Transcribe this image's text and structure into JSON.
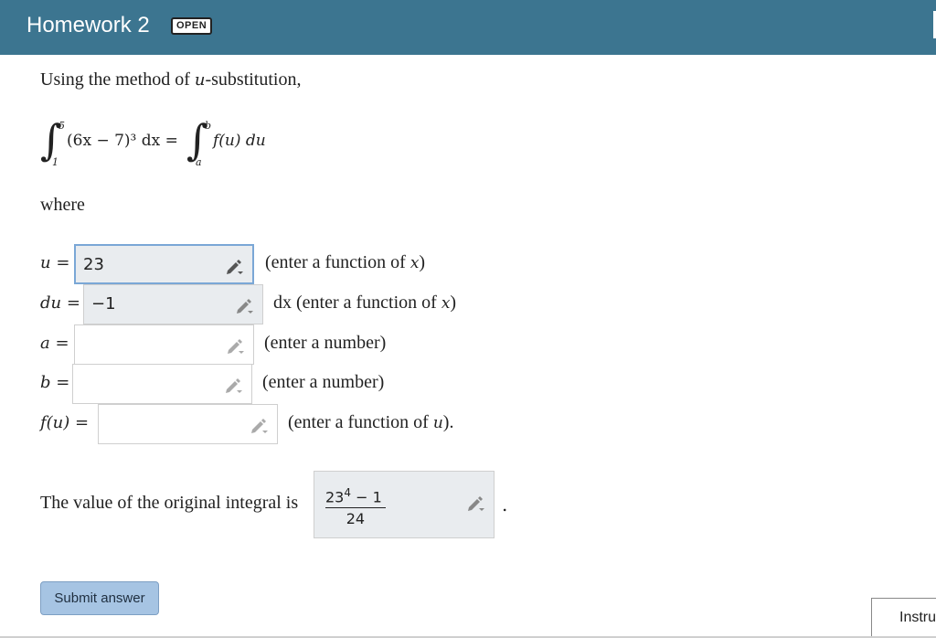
{
  "header": {
    "title": "Homework 2",
    "badge": "OPEN"
  },
  "problem": {
    "intro_prefix": "Using the method of ",
    "intro_var": "u",
    "intro_suffix": "-substitution,",
    "integral_left": {
      "upper": "5",
      "lower": "1",
      "expr": "(6x − 7)³ dx ="
    },
    "integral_right": {
      "upper": "b",
      "lower": "a",
      "expr": "f(u) du"
    },
    "where": "where"
  },
  "fields": [
    {
      "label": "u =",
      "value": "23",
      "hint_prefix": "(enter a function of ",
      "hint_var": "x",
      "hint_suffix": ")"
    },
    {
      "label": "du =",
      "value": "−1",
      "hint_prefix": "dx (enter a function of ",
      "hint_var": "x",
      "hint_suffix": ")"
    },
    {
      "label": "a =",
      "value": "",
      "hint_prefix": "(enter a number)",
      "hint_var": "",
      "hint_suffix": ""
    },
    {
      "label": "b =",
      "value": "",
      "hint_prefix": "(enter a number)",
      "hint_var": "",
      "hint_suffix": ""
    },
    {
      "label": "f(u) =",
      "value": "",
      "hint_prefix": "(enter a function of ",
      "hint_var": "u",
      "hint_suffix": ")."
    }
  ],
  "result": {
    "label": "The value of the original integral is",
    "numerator_base": "23",
    "numerator_exp": "4",
    "numerator_rest": " − 1",
    "denominator": "24",
    "period": "."
  },
  "submit_label": "Submit answer",
  "side_tab_label": "Instructions",
  "icons": {
    "edit": "pencil-edit-icon"
  },
  "colors": {
    "header_bg": "#3c7590",
    "button_bg": "#a6c4e3",
    "field_filled": "#e9ecef",
    "focus_border": "#7aa7d6"
  }
}
